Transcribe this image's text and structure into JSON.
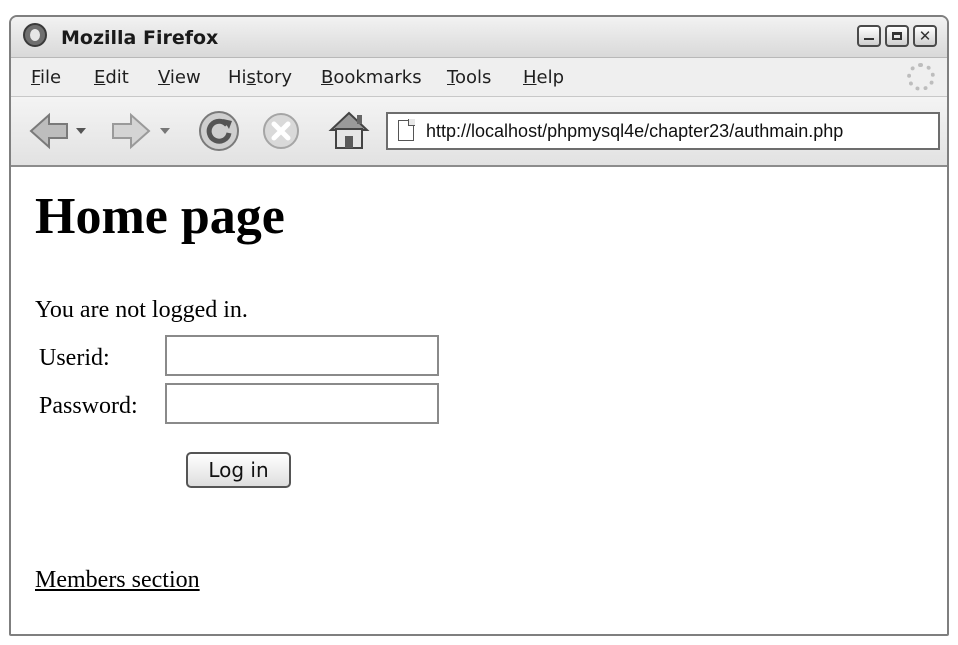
{
  "window": {
    "title": "Mozilla Firefox",
    "controls": {
      "minimize": "minimize-icon",
      "maximize": "maximize-icon",
      "close": "✕"
    }
  },
  "menu": {
    "items": [
      {
        "accel": "F",
        "rest": "ile"
      },
      {
        "accel": "E",
        "rest": "dit"
      },
      {
        "accel": "V",
        "rest": "iew"
      },
      {
        "pre": "Hi",
        "accel": "s",
        "rest": "tory"
      },
      {
        "accel": "B",
        "rest": "ookmarks"
      },
      {
        "accel": "T",
        "rest": "ools"
      },
      {
        "accel": "H",
        "rest": "elp"
      }
    ]
  },
  "toolbar": {
    "icons": [
      "back-icon",
      "back-dropdown-icon",
      "forward-icon",
      "forward-dropdown-icon",
      "reload-icon",
      "stop-icon",
      "home-icon"
    ],
    "url": "http://localhost/phpmysql4e/chapter23/authmain.php"
  },
  "page": {
    "heading": "Home page",
    "status": "You are not logged in.",
    "userid_label": "Userid:",
    "userid_value": "",
    "password_label": "Password:",
    "password_value": "",
    "login_button": "Log in",
    "members_link": "Members section"
  }
}
